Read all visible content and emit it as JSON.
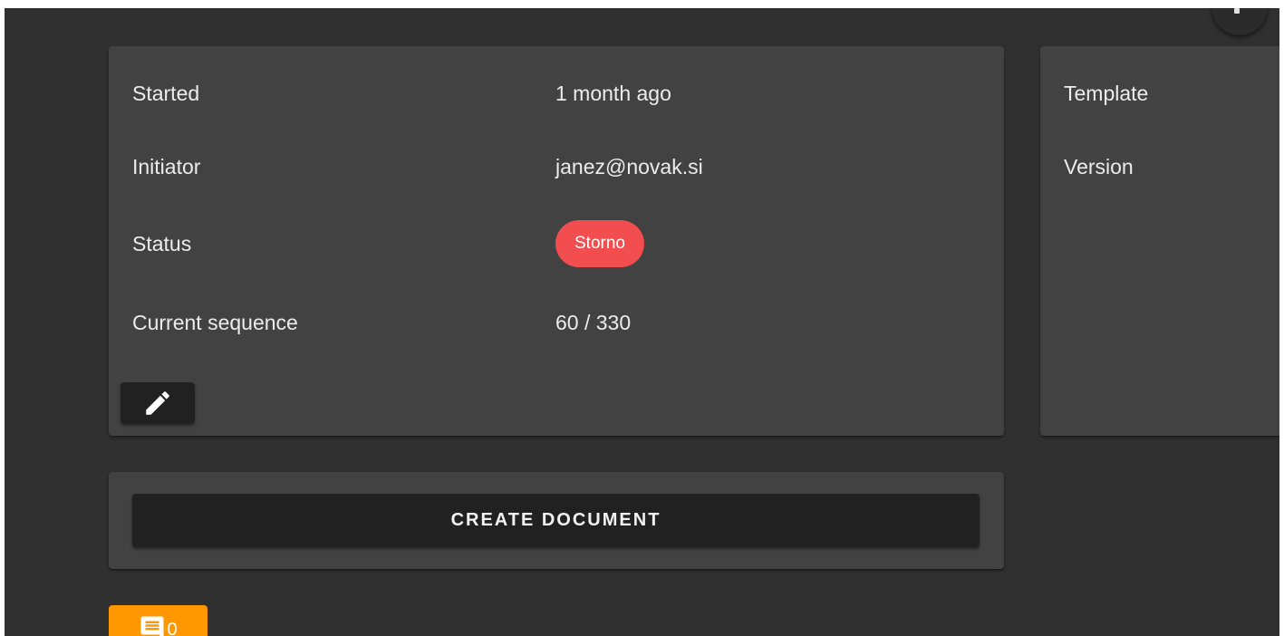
{
  "info": {
    "rows": [
      {
        "label": "Started",
        "value": "1 month ago"
      },
      {
        "label": "Initiator",
        "value": "janez@novak.si"
      },
      {
        "label": "Status",
        "value": "Storno"
      },
      {
        "label": "Current sequence",
        "value": "60 / 330"
      }
    ],
    "edit_icon": "pencil-icon"
  },
  "template_card": {
    "labels": [
      "Template",
      "Version"
    ]
  },
  "actions": {
    "create_document_label": "CREATE DOCUMENT"
  },
  "comments": {
    "icon": "comment-icon",
    "count": "0"
  },
  "colors": {
    "background": "#303030",
    "card": "#424242",
    "button": "#212121",
    "status_storno": "#f24d4f",
    "accent": "#ff9800"
  }
}
